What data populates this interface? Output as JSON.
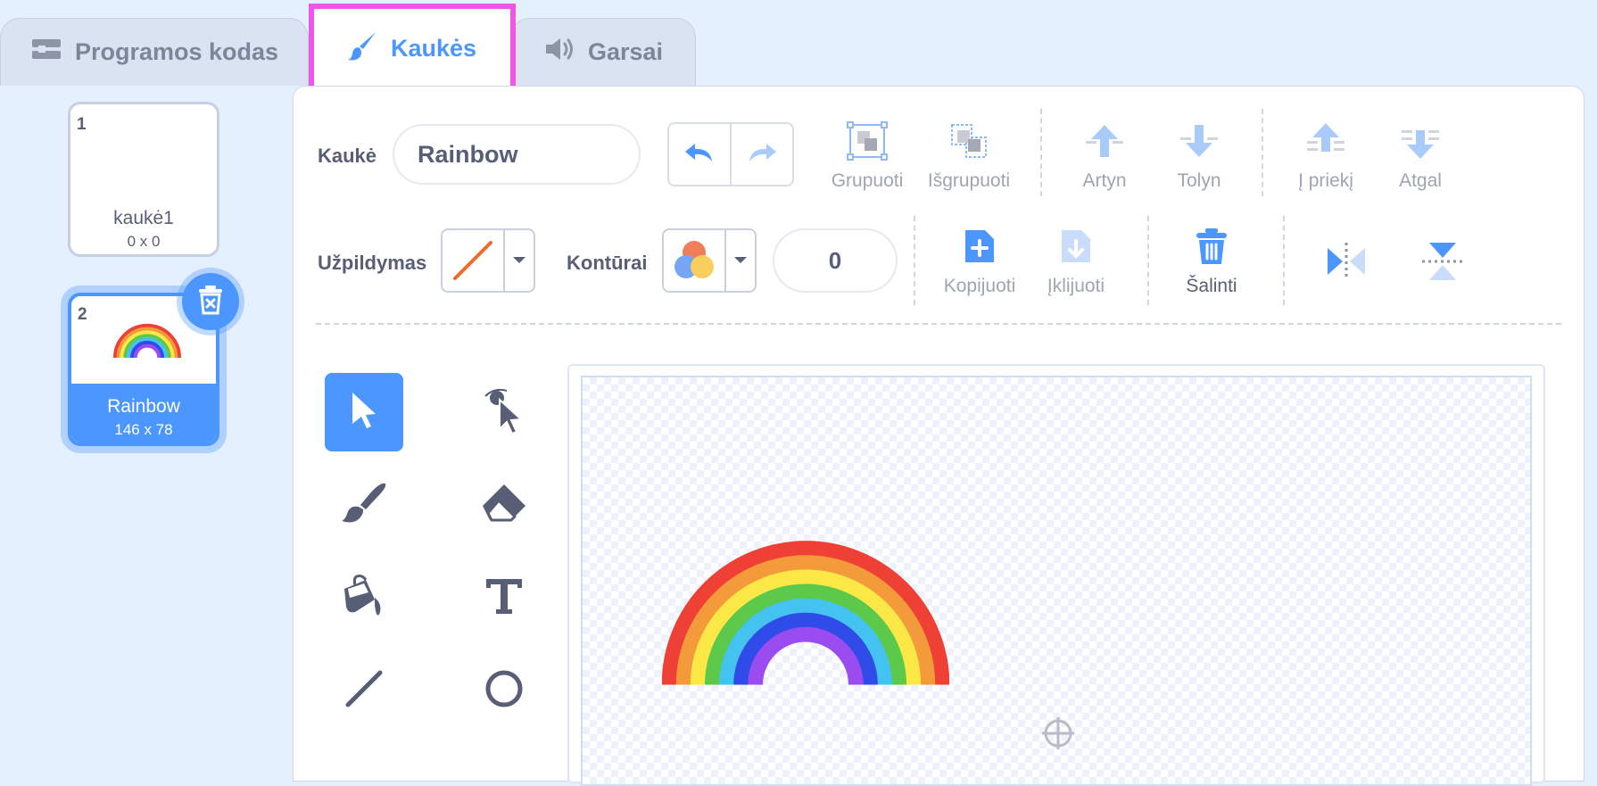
{
  "tabs": [
    {
      "label": "Programos kodas",
      "icon": "code-blocks-icon"
    },
    {
      "label": "Kaukės",
      "icon": "paintbrush-icon"
    },
    {
      "label": "Garsai",
      "icon": "speaker-icon"
    }
  ],
  "active_tab": "Kaukės",
  "costumes": [
    {
      "number": "1",
      "name": "kaukė1",
      "size": "0 x 0"
    },
    {
      "number": "2",
      "name": "Rainbow",
      "size": "146 x 78"
    }
  ],
  "selected_costume": "Rainbow",
  "toolbar": {
    "costume_label": "Kaukė",
    "costume_name": "Rainbow",
    "group": "Grupuoti",
    "ungroup": "Išgrupuoti",
    "forward": "Artyn",
    "backward": "Tolyn",
    "front": "Į priekį",
    "back": "Atgal",
    "fill_label": "Užpildymas",
    "outline_label": "Kontūrai",
    "outline_width": "0",
    "copy": "Kopijuoti",
    "paste": "Įklijuoti",
    "delete": "Šalinti"
  },
  "tools": [
    "select-tool",
    "reshape-tool",
    "brush-tool",
    "eraser-tool",
    "fill-tool",
    "text-tool",
    "line-tool",
    "circle-tool"
  ],
  "colors": {
    "accent": "#4c97ff",
    "highlight": "#ee55e8",
    "fill_none_slash": "#f06a2a",
    "rainbow": [
      "#ee4035",
      "#f39a3a",
      "#fbe846",
      "#5cc94a",
      "#45c3f0",
      "#2f4be8",
      "#9a4cf0"
    ]
  }
}
